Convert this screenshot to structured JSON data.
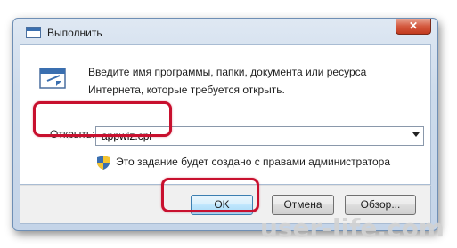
{
  "window": {
    "title": "Выполнить",
    "close_label": "✕"
  },
  "dialog": {
    "description": "Введите имя программы, папки, документа или ресурса Интернета, которые требуется открыть.",
    "open_label": "Открыть:",
    "open_value": "appwiz.cpl",
    "admin_note": "Это задание будет создано с правами администратора"
  },
  "buttons": {
    "ok": "OK",
    "cancel": "Отмена",
    "browse": "Обзор..."
  },
  "watermark": "user-life.com",
  "colors": {
    "highlight": "#c8102e",
    "title_bg": "#cddbeb"
  },
  "icons": [
    "run-icon",
    "shield-icon",
    "close-icon"
  ]
}
